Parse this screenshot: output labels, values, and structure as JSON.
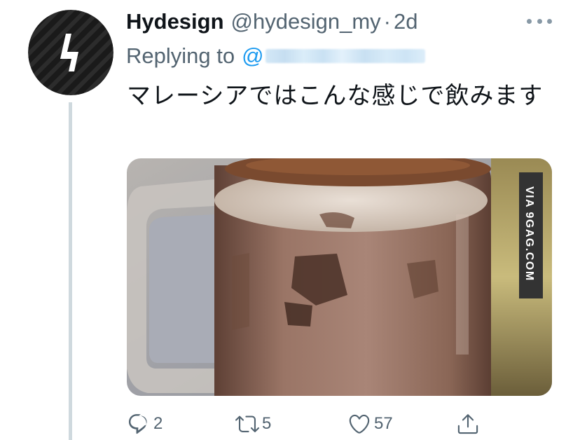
{
  "tweet": {
    "display_name": "Hydesign",
    "handle": "@hydesign_my",
    "separator": "·",
    "time": "2d",
    "replying_prefix": "Replying to",
    "replying_at": "@",
    "text": "マレーシアではこんな感じで飲みます",
    "media": {
      "watermark": "VIA 9GAG.COM"
    },
    "stats": {
      "replies": "2",
      "retweets": "5",
      "likes": "57"
    }
  },
  "icons": {
    "more": "more-horizontal-icon",
    "reply": "reply-bubble-icon",
    "retweet": "retweet-icon",
    "like": "heart-icon",
    "share": "share-icon"
  },
  "colors": {
    "link": "#1d9bf0",
    "secondary_text": "#536471",
    "thread_line": "#cfd9de"
  }
}
